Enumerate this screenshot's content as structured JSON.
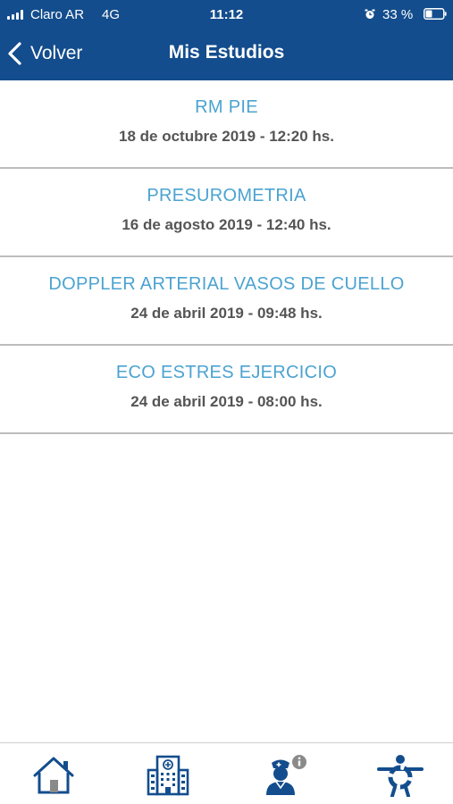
{
  "status_bar": {
    "carrier": "Claro AR",
    "network": "4G",
    "time": "11:12",
    "battery": "33 %"
  },
  "nav": {
    "back_label": "Volver",
    "title": "Mis Estudios"
  },
  "studies": [
    {
      "name": "RM PIE",
      "date": "18 de octubre 2019 - 12:20 hs."
    },
    {
      "name": "PRESUROMETRIA",
      "date": "16 de agosto 2019 - 12:40 hs."
    },
    {
      "name": "DOPPLER ARTERIAL VASOS DE CUELLO",
      "date": "24 de abril 2019 - 09:48 hs."
    },
    {
      "name": "ECO ESTRES EJERCICIO",
      "date": "24 de abril 2019 - 08:00 hs."
    }
  ],
  "tabs": [
    {
      "icon": "home-icon"
    },
    {
      "icon": "hospital-icon"
    },
    {
      "icon": "nurse-info-icon"
    },
    {
      "icon": "lifeguard-person-icon"
    }
  ],
  "colors": {
    "header_bg": "#134D8D",
    "study_name": "#4BA3D1",
    "study_date": "#555555",
    "divider": "#BDBDBD",
    "icon_blue": "#134D8D"
  }
}
